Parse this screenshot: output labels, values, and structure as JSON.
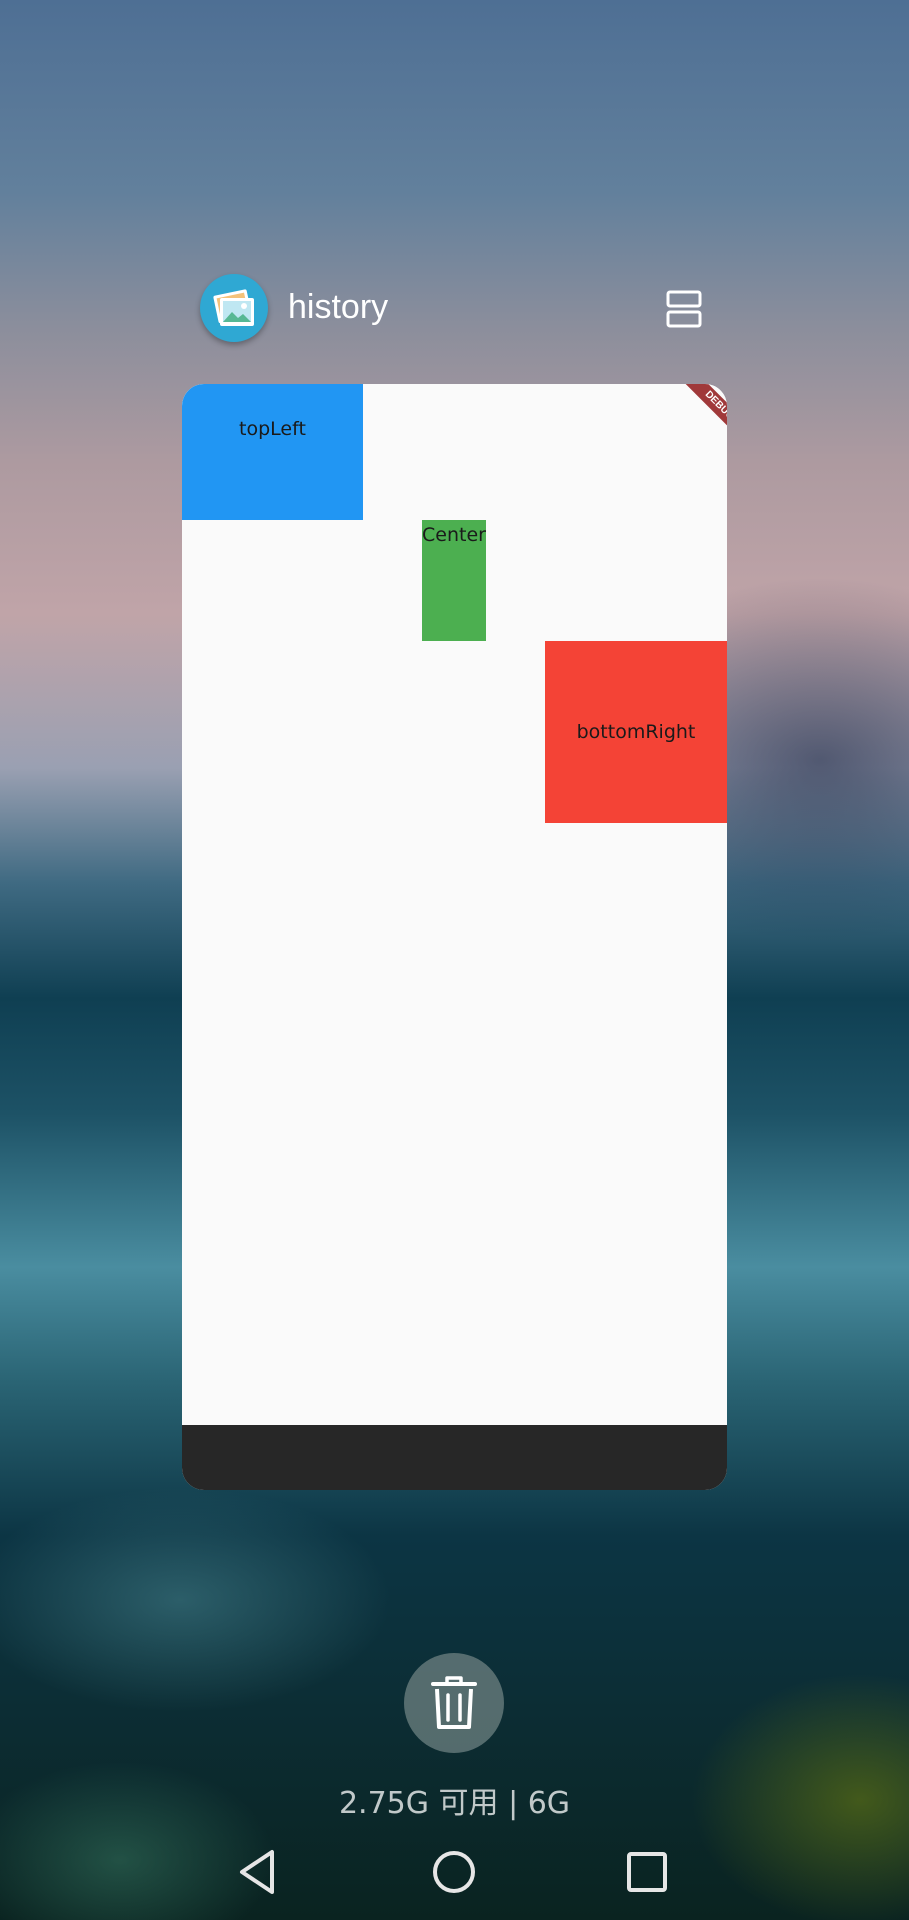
{
  "header": {
    "app_title": "history",
    "app_icon": "gallery-icon",
    "split_icon": "split-screen-icon"
  },
  "preview": {
    "boxes": {
      "top_left": "topLeft",
      "center": "Center",
      "bottom_right": "bottomRight"
    },
    "colors": {
      "top_left": "#2196f3",
      "center": "#4caf50",
      "bottom_right": "#f44336",
      "background": "#fafafa",
      "nav_strip": "#272727"
    },
    "debug_banner": "DEBUG"
  },
  "controls": {
    "clear_icon": "trash-icon",
    "memory_text": "2.75G 可用 | 6G"
  },
  "navbar": {
    "back_icon": "back-triangle-icon",
    "home_icon": "home-circle-icon",
    "recents_icon": "recents-square-icon"
  }
}
